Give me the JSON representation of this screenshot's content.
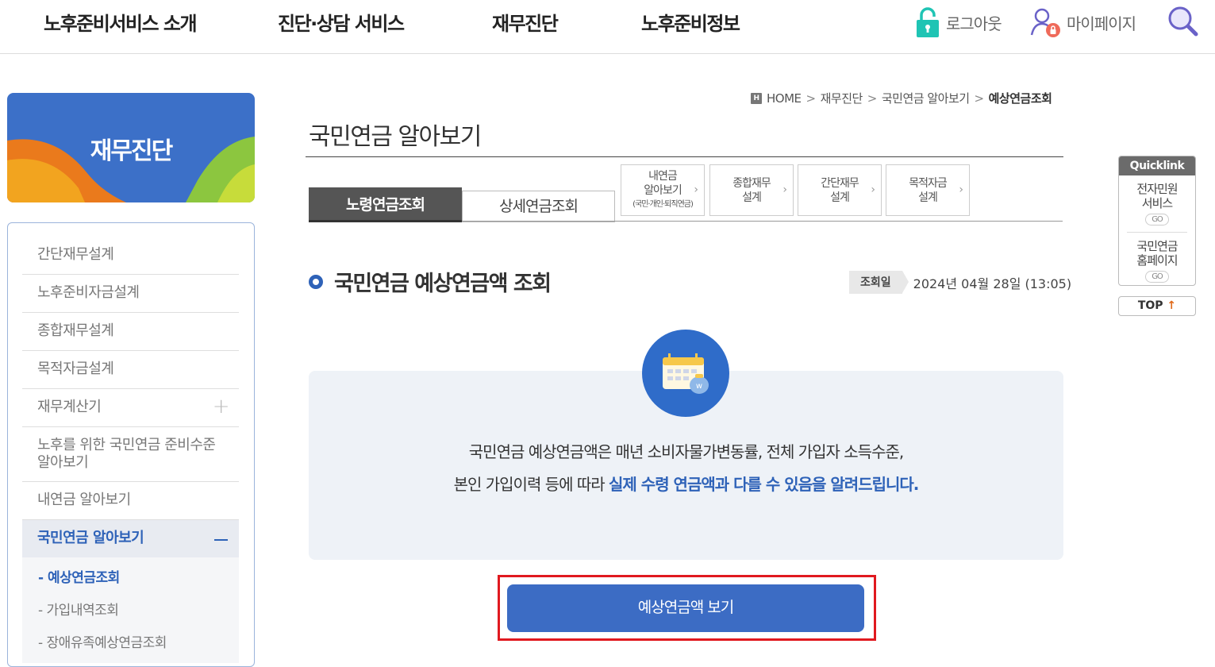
{
  "nav": {
    "menu": [
      "노후준비서비스 소개",
      "진단·상담 서비스",
      "재무진단",
      "노후준비정보"
    ],
    "logout": "로그아웃",
    "mypage": "마이페이지"
  },
  "sidebar": {
    "banner_title": "재무진단",
    "items": [
      {
        "label": "간단재무설계"
      },
      {
        "label": "노후준비자금설계"
      },
      {
        "label": "종합재무설계"
      },
      {
        "label": "목적자금설계"
      },
      {
        "label": "재무계산기"
      },
      {
        "label": "노후를 위한 국민연금 준비수준 알아보기"
      },
      {
        "label": "내연금 알아보기"
      },
      {
        "label": "국민연금 알아보기"
      }
    ],
    "sub_items": [
      "예상연금조회",
      "가입내역조회",
      "장애유족예상연금조회"
    ]
  },
  "breadcrumb": {
    "home_icon_text": "H",
    "items": [
      "HOME",
      "재무진단",
      "국민연금 알아보기",
      "예상연금조회"
    ]
  },
  "page_title": "국민연금 알아보기",
  "tabs": [
    "노령연금조회",
    "상세연금조회"
  ],
  "quick_buttons": [
    {
      "line1": "내연금",
      "line2": "알아보기",
      "line3": "(국민·개인·퇴직연금)"
    },
    {
      "line1": "종합재무",
      "line2": "설계"
    },
    {
      "line1": "간단재무",
      "line2": "설계"
    },
    {
      "line1": "목적자금",
      "line2": "설계"
    }
  ],
  "section": {
    "title": "국민연금 예상연금액 조회",
    "inquiry_label": "조회일",
    "inquiry_date": "2024년 04월 28일 (13:05)"
  },
  "info": {
    "line1": "국민연금 예상연금액은 매년 소비자물가변동률, 전체 가입자 소득수준,",
    "line2_plain": "본인 가입이력 등에 따라 ",
    "line2_highlight": "실제 수령 연금액과 다를 수 있음을 알려드립니다."
  },
  "main_button": "예상연금액 보기",
  "quicklink": {
    "title": "Quicklink",
    "items": [
      {
        "line1": "전자민원",
        "line2": "서비스",
        "go": "GO"
      },
      {
        "line1": "국민연금",
        "line2": "홈페이지",
        "go": "GO"
      }
    ],
    "top_label": "TOP",
    "top_arrow": "↑"
  },
  "colors": {
    "primary": "#3c6cc4",
    "accent_text": "#2e62b8",
    "highlight_frame": "#e0191f",
    "lock_icon": "#1fc4b4"
  },
  "icons": [
    "lock-icon",
    "user-alert-icon",
    "search-icon",
    "calendar-money-icon",
    "plus-icon",
    "minus-icon",
    "home-icon",
    "chevron-right-icon"
  ]
}
